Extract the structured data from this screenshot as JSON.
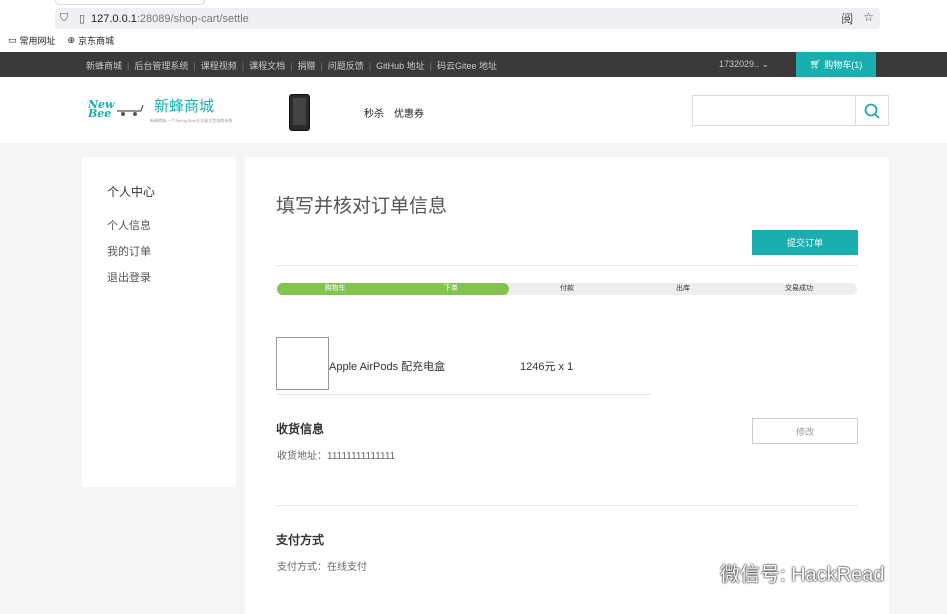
{
  "browser": {
    "url_host": "127.0.0.1",
    "url_path": ":28089/shop-cart/settle",
    "right_icon_1": "阅",
    "bookmarks": [
      "常用网址",
      "京东商城"
    ]
  },
  "topnav": {
    "links": [
      "新蜂商城",
      "后台管理系统",
      "课程视频",
      "课程文档",
      "捐赠",
      "问题反馈",
      "GitHub 地址",
      "码云Gitee 地址"
    ],
    "user": "1732029.. ",
    "cart_label": "购物车(1)"
  },
  "header": {
    "logo_line1": "New",
    "logo_line2": "Bee",
    "brand_name": "新蜂商城",
    "slogan": "新蜂商城-一个Spring Boot企业级大型电商系统",
    "nav": [
      "秒杀",
      "优惠券"
    ],
    "search_placeholder": ""
  },
  "sidebar": {
    "title": "个人中心",
    "items": [
      "个人信息",
      "我的订单",
      "退出登录"
    ]
  },
  "main": {
    "title": "填写并核对订单信息",
    "submit_label": "提交订单",
    "progress_steps": [
      "购物车",
      "下单",
      "付款",
      "出库",
      "交易成功"
    ],
    "progress_done": 2,
    "progress_total": 5,
    "product_name": "Apple AirPods 配充电盒",
    "product_price": "1246元 x 1",
    "address_title": "收货信息",
    "address_line": "收货地址：11111111111111",
    "edit_label": "修改",
    "payment_title": "支付方式",
    "payment_line": "支付方式：在线支付"
  },
  "watermark": "微信号: HackRead",
  "colors": {
    "accent": "#1baeae",
    "progress": "#83c44e",
    "topbar": "#3a3a3a"
  }
}
